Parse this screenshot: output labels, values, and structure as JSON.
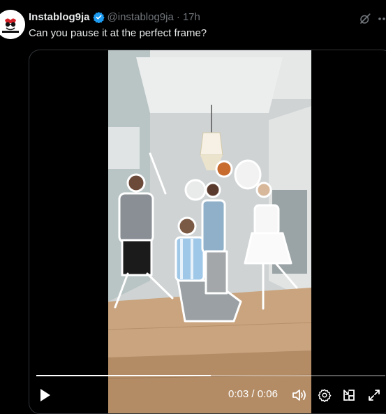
{
  "tweet": {
    "display_name": "Instablog9ja",
    "handle": "@instablog9ja",
    "separator": "·",
    "timestamp": "17h",
    "text": "Can you pause it at the perfect frame?",
    "verified": true,
    "avatar_icon": "instablog9ja-logo"
  },
  "video": {
    "current_time": "0:03",
    "time_separator": " / ",
    "duration": "0:06",
    "progress": 0.5,
    "controls": {
      "play_icon": "play-icon",
      "volume_icon": "volume-icon",
      "settings_icon": "gear-icon",
      "pip_icon": "picture-in-picture-icon",
      "fullscreen_icon": "fullscreen-icon"
    }
  },
  "colors": {
    "background": "#000000",
    "primary_text": "#e7e9ea",
    "secondary_text": "#71767b",
    "verified_blue": "#1d9bf0",
    "border": "#2f3336"
  }
}
